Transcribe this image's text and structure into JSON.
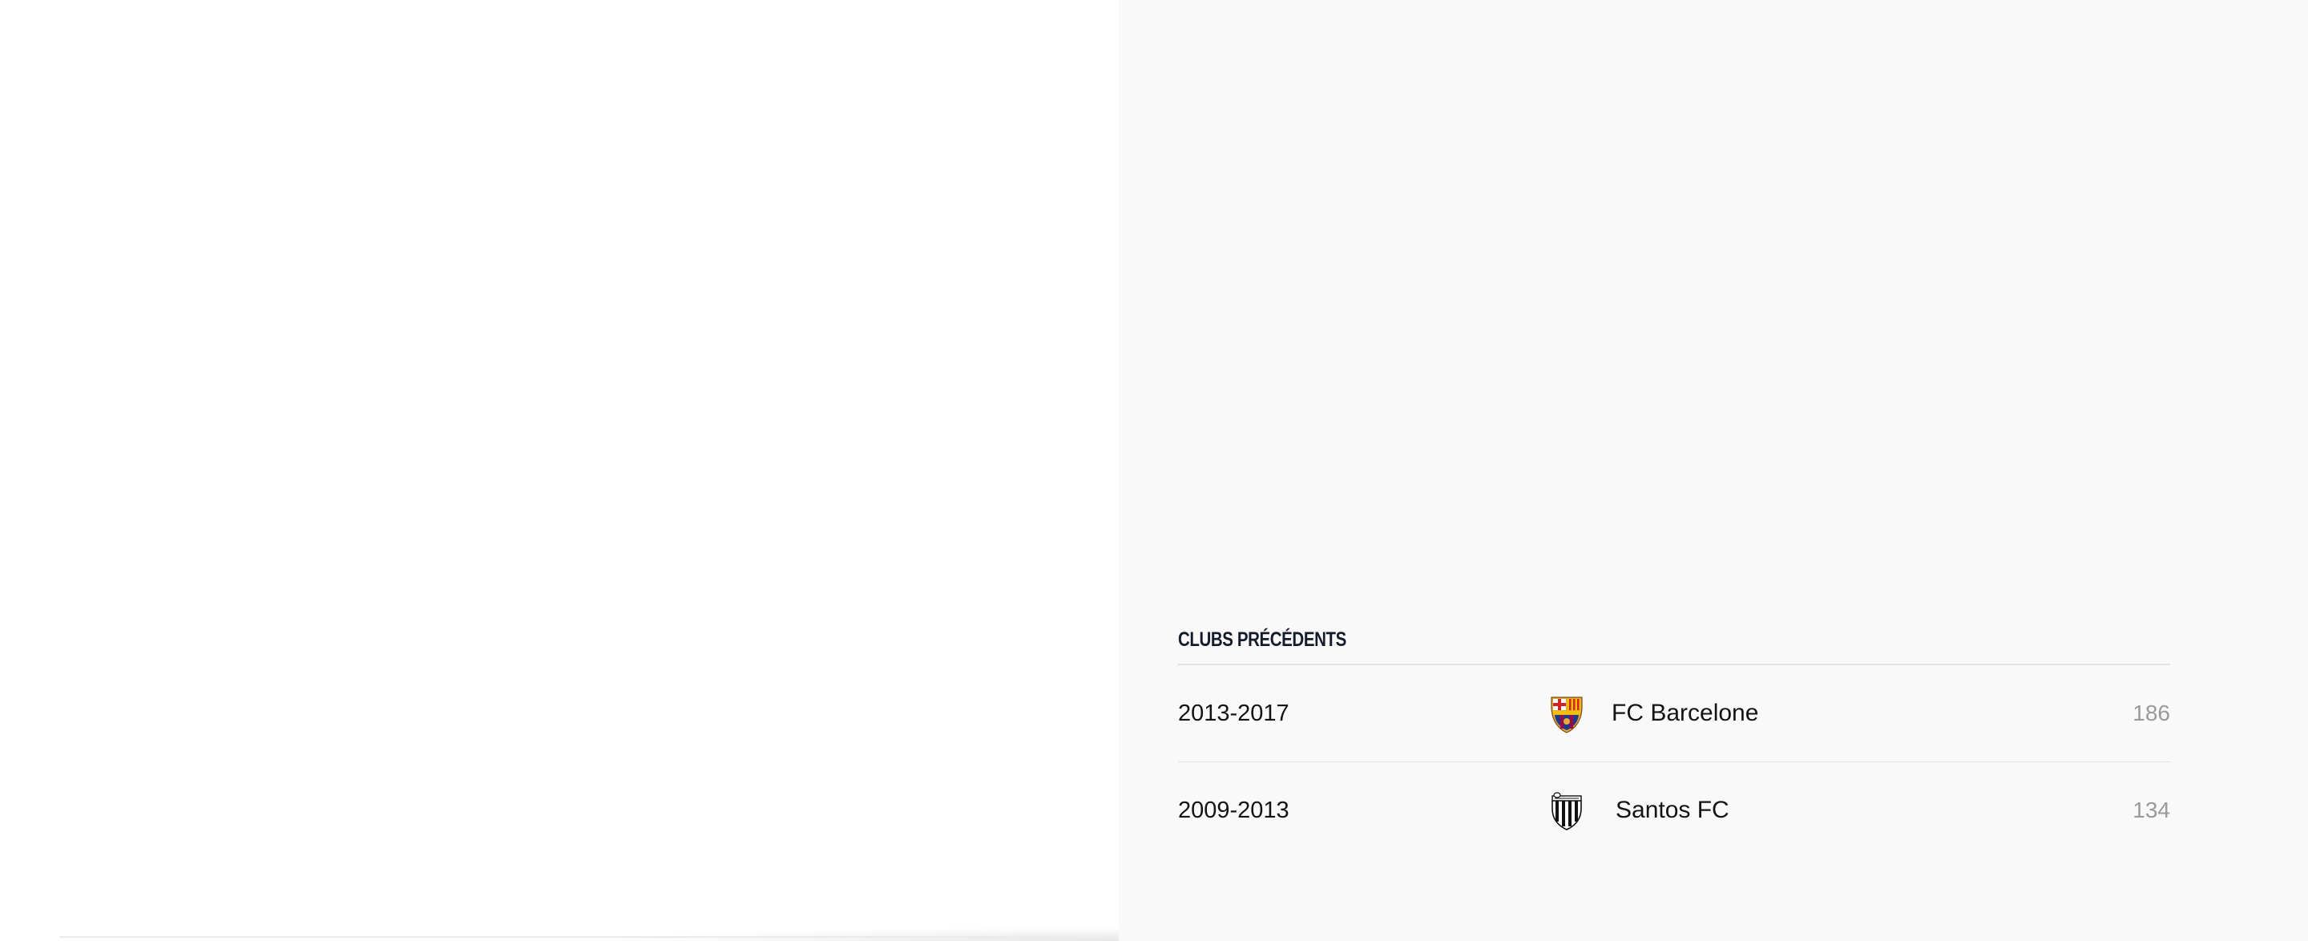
{
  "clubs_section": {
    "title": "CLUBS PRÉCÉDENTS",
    "clubs": [
      {
        "years": "2013-2017",
        "name": "FC Barcelone",
        "apps": "186",
        "crest_icon": "fc-barcelona-crest-icon"
      },
      {
        "years": "2009-2013",
        "name": "Santos FC",
        "apps": "134",
        "crest_icon": "santos-fc-crest-icon"
      }
    ]
  },
  "colors": {
    "left_background": "#ffffff",
    "right_background": "#f9f9f9",
    "title": "#141c2b",
    "muted_number": "#9a9a9a"
  }
}
